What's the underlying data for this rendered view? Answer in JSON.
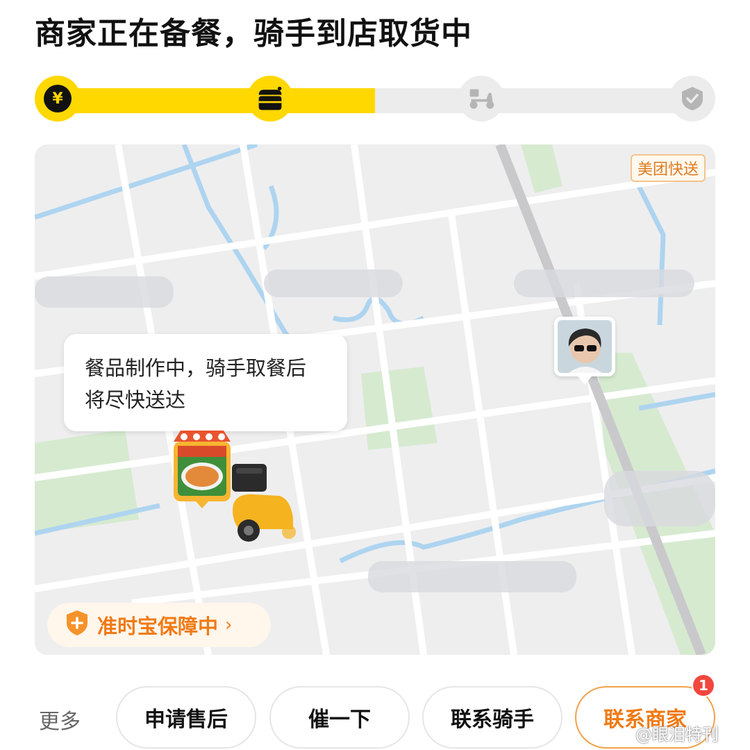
{
  "header": {
    "title": "商家正在备餐，骑手到店取货中"
  },
  "progress": {
    "steps": [
      {
        "name": "paid",
        "icon": "yen-icon",
        "state": "done",
        "symbol": "¥"
      },
      {
        "name": "preparing",
        "icon": "shop-icon",
        "state": "done"
      },
      {
        "name": "delivering",
        "icon": "scooter-icon",
        "state": "pending"
      },
      {
        "name": "delivered",
        "icon": "check-icon",
        "state": "pending"
      }
    ],
    "fill_fraction": 0.5
  },
  "map": {
    "brand_tag": "美团快送",
    "status_bubble_line1": "餐品制作中，骑手取餐后",
    "status_bubble_line2": "将尽快送达",
    "guarantee_label": "准时宝保障中",
    "guarantee_chevron": "›"
  },
  "actions": {
    "more_label": "更多",
    "buttons": [
      {
        "label": "申请售后"
      },
      {
        "label": "催一下"
      },
      {
        "label": "联系骑手"
      },
      {
        "label": "联系商家"
      }
    ],
    "merchant_badge": "1"
  },
  "watermark": "@眼泪特刊",
  "colors": {
    "accent_yellow": "#ffd800",
    "accent_orange": "#f07a14",
    "badge_red": "#f2473f"
  }
}
